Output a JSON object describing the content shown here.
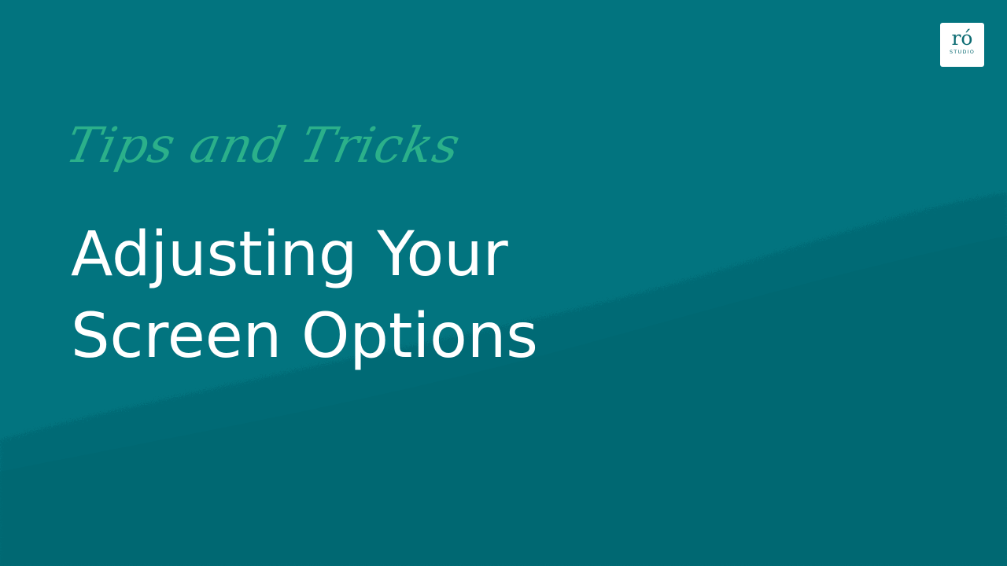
{
  "slide": {
    "script_heading": "Tips and Tricks",
    "title_line_1": "Adjusting Your",
    "title_line_2": "Screen Options"
  },
  "logo": {
    "mark": "ró",
    "sub": "STUDIO"
  },
  "colors": {
    "background": "#02747f",
    "script_accent": "#2bb08a",
    "title_text": "#ffffff",
    "logo_text": "#0b6b72"
  }
}
